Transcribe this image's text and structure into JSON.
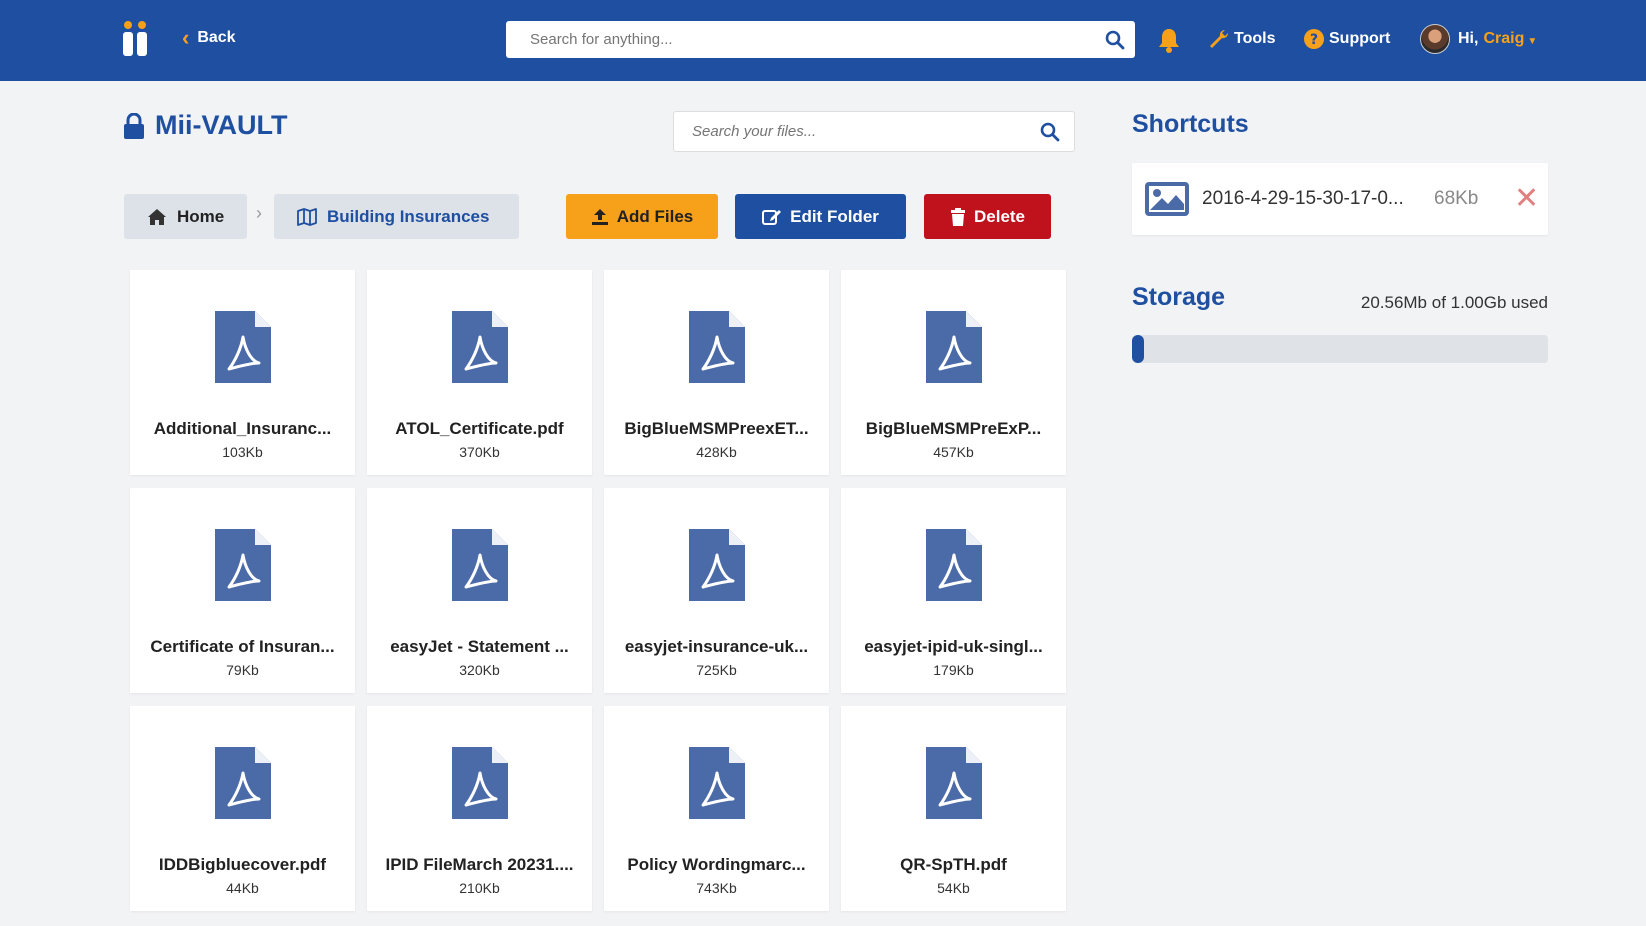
{
  "header": {
    "back_label": "Back",
    "search_placeholder": "Search for anything...",
    "tools_label": "Tools",
    "support_label": "Support",
    "greeting": "Hi,",
    "user_name": "Craig"
  },
  "vault": {
    "title": "Mii-VAULT",
    "file_search_placeholder": "Search your files..."
  },
  "breadcrumb": {
    "home": "Home",
    "current": "Building Insurances"
  },
  "actions": {
    "add_files": "Add Files",
    "edit_folder": "Edit Folder",
    "delete": "Delete"
  },
  "files": [
    {
      "name": "Additional_Insuranc...",
      "size": "103Kb"
    },
    {
      "name": "ATOL_Certificate.pdf",
      "size": "370Kb"
    },
    {
      "name": "BigBlueMSMPreexET...",
      "size": "428Kb"
    },
    {
      "name": "BigBlueMSMPreExP...",
      "size": "457Kb"
    },
    {
      "name": "Certificate of Insuran...",
      "size": "79Kb"
    },
    {
      "name": "easyJet - Statement ...",
      "size": "320Kb"
    },
    {
      "name": "easyjet-insurance-uk...",
      "size": "725Kb"
    },
    {
      "name": "easyjet-ipid-uk-singl...",
      "size": "179Kb"
    },
    {
      "name": "IDDBigbluecover.pdf",
      "size": "44Kb"
    },
    {
      "name": "IPID FileMarch 20231....",
      "size": "210Kb"
    },
    {
      "name": "Policy Wordingmarc...",
      "size": "743Kb"
    },
    {
      "name": "QR-SpTH.pdf",
      "size": "54Kb"
    }
  ],
  "shortcuts": {
    "title": "Shortcuts",
    "items": [
      {
        "name": "2016-4-29-15-30-17-0...",
        "size": "68Kb",
        "remove": "✕"
      }
    ]
  },
  "storage": {
    "title": "Storage",
    "used_text": "20.56Mb of 1.00Gb used",
    "used_fraction": 0.0201
  },
  "colors": {
    "brand_blue": "#1e4fa0",
    "accent_orange": "#f7a11a",
    "danger_red": "#c0121d"
  }
}
